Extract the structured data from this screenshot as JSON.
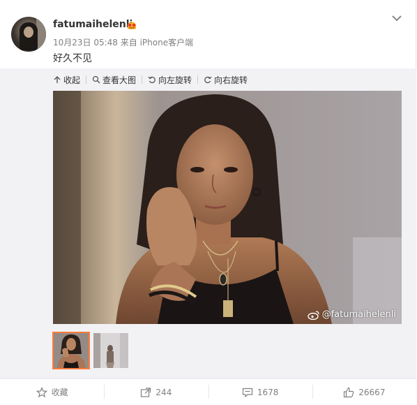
{
  "post": {
    "username": "fatumaihelenli",
    "timestamp": "10月23日 05:48",
    "source": "来自 iPhone客户端",
    "text": "好久不见"
  },
  "toolbar": {
    "collapse": "收起",
    "view_large": "查看大图",
    "rotate_left": "向左旋转",
    "rotate_right": "向右旋转"
  },
  "photo": {
    "watermark": "@fatumaihelenli"
  },
  "thumbnails": [
    {
      "label": "thumbnail-1",
      "selected": true
    },
    {
      "label": "thumbnail-2",
      "selected": false
    }
  ],
  "actions": {
    "favorite": "收藏",
    "repost_count": "244",
    "comment_count": "1678",
    "like_count": "26667"
  },
  "colors": {
    "accent": "#fa7d3c",
    "panel_bg": "#f2f2f5",
    "meta_text": "#808080"
  },
  "icons": [
    "chevron-down-icon",
    "vip-badge-icon",
    "collapse-icon",
    "zoom-icon",
    "rotate-left-icon",
    "rotate-right-icon",
    "weibo-logo-icon",
    "star-icon",
    "repost-icon",
    "comment-icon",
    "like-icon"
  ]
}
